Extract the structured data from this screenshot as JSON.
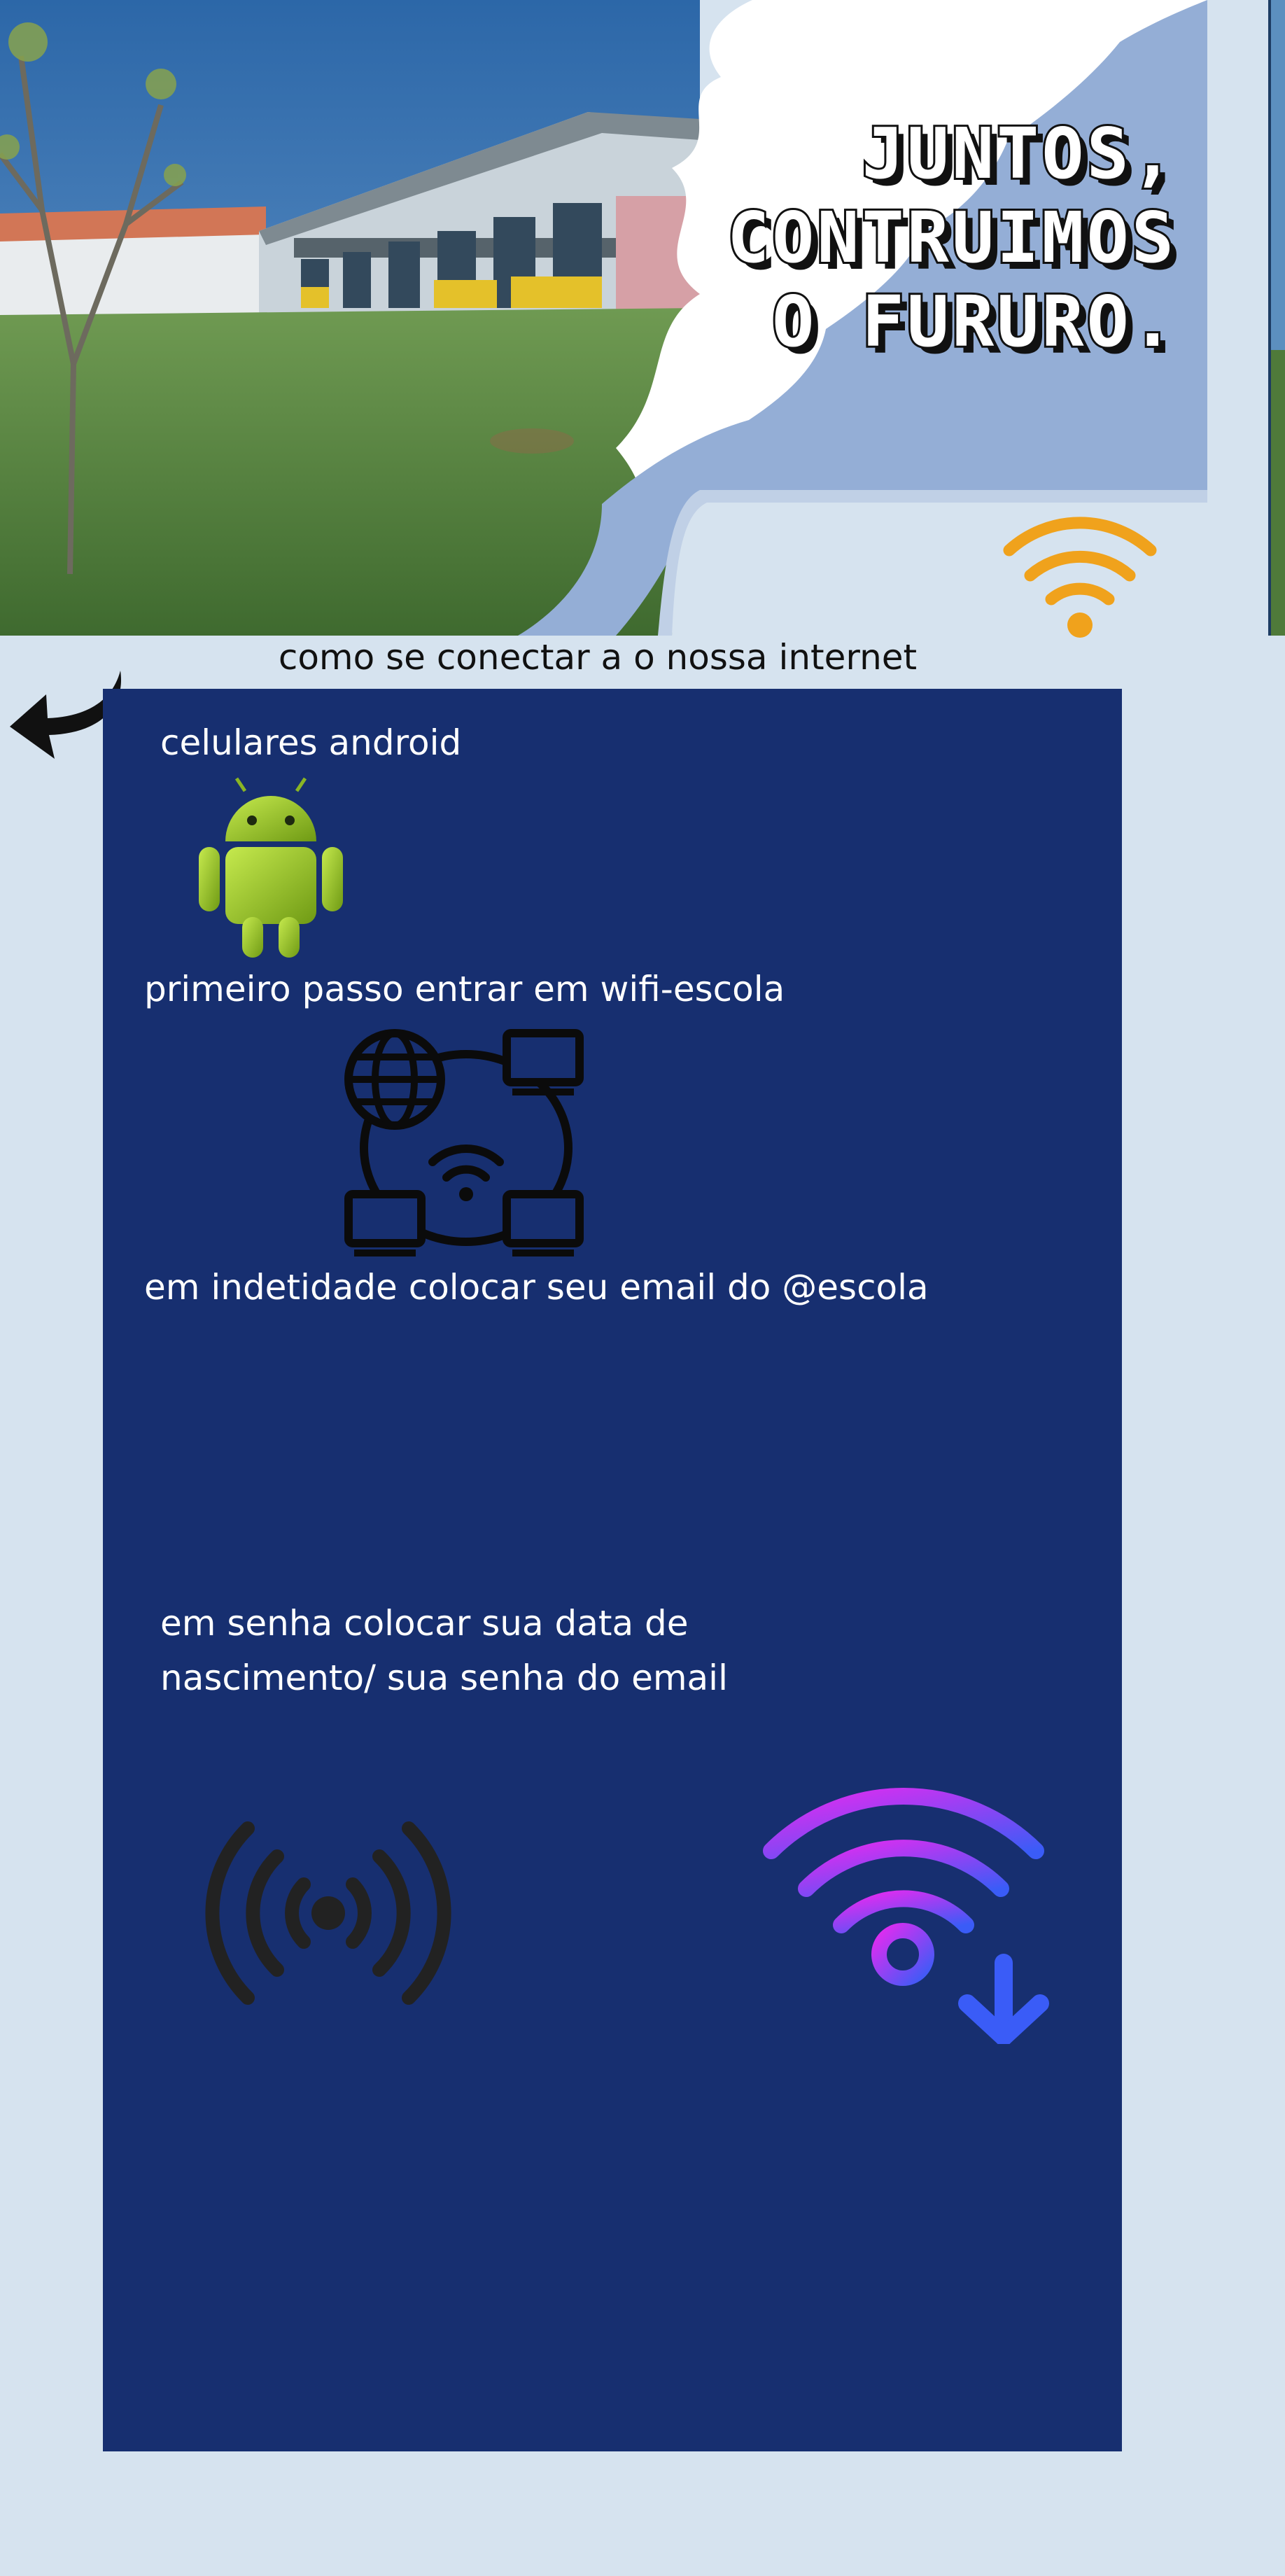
{
  "hero": {
    "title_lines": [
      "JUNTOS,",
      "CONTRUIMOS",
      "O FURURO."
    ],
    "image": "school-building-photo"
  },
  "subtitle": "como se conectar a o nossa internet",
  "steps": {
    "heading": "celulares android",
    "step1": "primeiro passo entrar em wifi-escola",
    "step2": "em indetidade colocar seu email do @escola",
    "step3_line1": "em senha colocar sua data de",
    "step3_line2": "nascimento/ sua senha do email"
  },
  "icons": {
    "top_wifi": "wifi-icon",
    "back": "curved-arrow-back-icon",
    "android": "android-robot-icon",
    "network": "network-globe-computers-icon",
    "broadcast": "broadcast-signal-icon",
    "wifi_download": "wifi-download-icon"
  },
  "colors": {
    "page_bg": "#d6e3ef",
    "panel_bg": "#172f70",
    "text_light": "#ffffff",
    "text_dark": "#111111",
    "wifi_orange": "#f0a21c",
    "android_green": "#9ccb2a",
    "gradient_magenta": "#e22bf0",
    "gradient_blue": "#3a5cf7"
  }
}
